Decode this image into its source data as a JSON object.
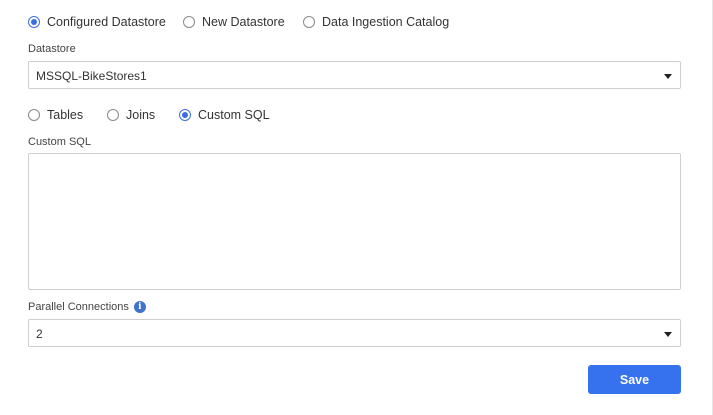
{
  "source_options": [
    {
      "label": "Configured Datastore",
      "checked": true
    },
    {
      "label": "New Datastore",
      "checked": false
    },
    {
      "label": "Data Ingestion Catalog",
      "checked": false
    }
  ],
  "datastore": {
    "label": "Datastore",
    "value": "MSSQL-BikeStores1"
  },
  "query_options": [
    {
      "label": "Tables",
      "checked": false
    },
    {
      "label": "Joins",
      "checked": false
    },
    {
      "label": "Custom SQL",
      "checked": true
    }
  ],
  "custom_sql": {
    "label": "Custom SQL",
    "value": ""
  },
  "parallel_connections": {
    "label": "Parallel Connections",
    "info_icon": "i",
    "value": "2"
  },
  "save_label": "Save",
  "colors": {
    "accent": "#3672ee",
    "radio_checked": "#3b6fe0",
    "info_icon": "#3f72c9"
  }
}
